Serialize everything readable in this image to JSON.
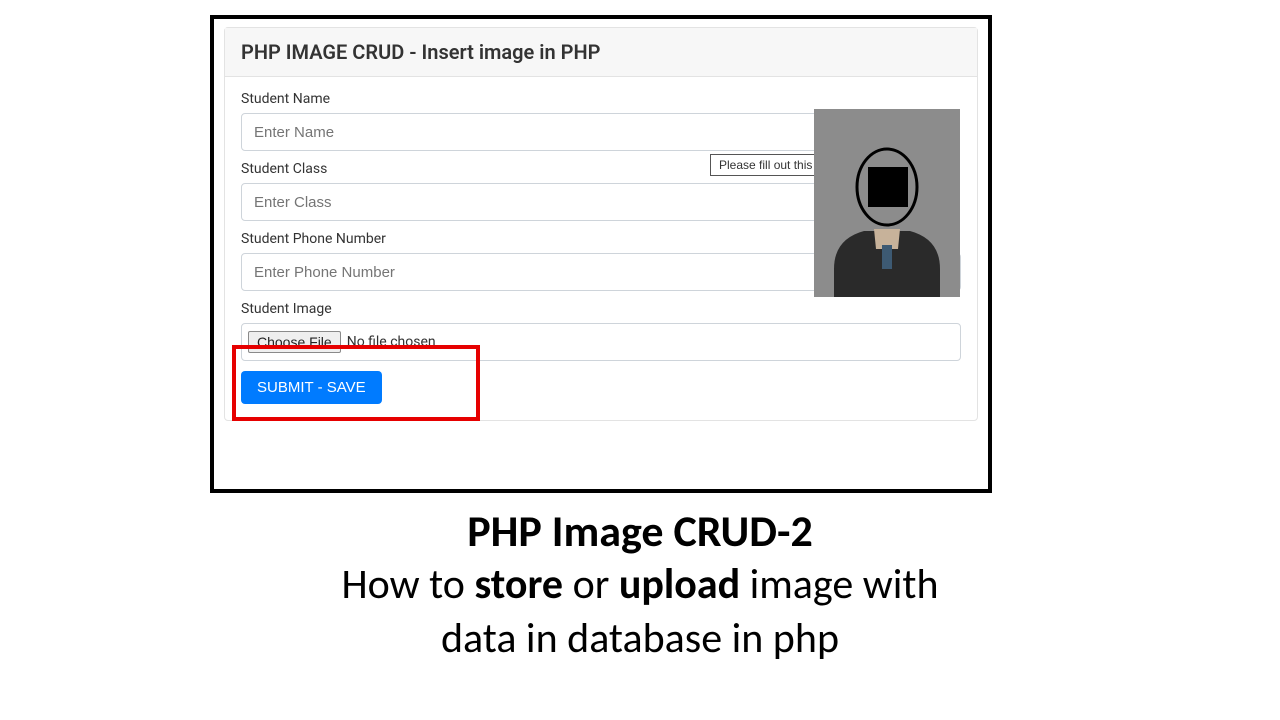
{
  "card": {
    "title": "PHP IMAGE CRUD - Insert image in PHP"
  },
  "form": {
    "name_label": "Student Name",
    "name_placeholder": "Enter Name",
    "class_label": "Student Class",
    "class_placeholder": "Enter Class",
    "phone_label": "Student Phone Number",
    "phone_placeholder": "Enter Phone Number",
    "image_label": "Student Image",
    "choose_file_label": "Choose File",
    "file_status": "No file chosen",
    "submit_label": "SUBMIT - SAVE"
  },
  "tooltip": {
    "text": "Please fill out this field."
  },
  "caption": {
    "title": "PHP Image CRUD-2",
    "line1_a": "How to ",
    "line1_b": "store",
    "line1_c": " or ",
    "line1_d": "upload",
    "line1_e": " image with",
    "line2": "data in database in php"
  }
}
